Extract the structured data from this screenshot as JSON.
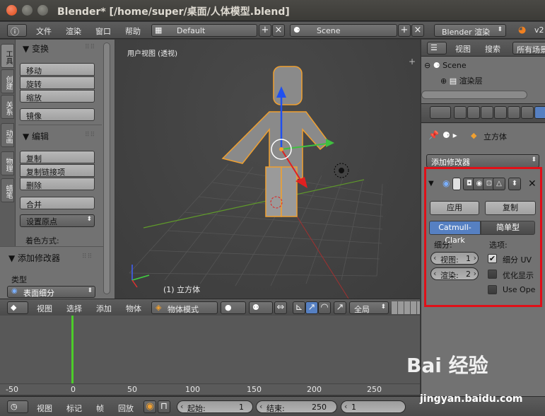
{
  "window": {
    "title": "Blender* [/home/super/桌面/人体模型.blend]"
  },
  "info_header": {
    "menus": [
      "文件",
      "渲染",
      "窗口",
      "帮助"
    ],
    "layout": "Default",
    "scene": "Scene",
    "engine": "Blender 渲染",
    "version": "v2"
  },
  "toolshelf": {
    "tabs": [
      "工具",
      "创建",
      "关系",
      "动画",
      "物理",
      "蜡笔"
    ],
    "transform_header": "▼ 变换",
    "transform_buttons": [
      "移动",
      "旋转",
      "缩放"
    ],
    "mirror": "镜像",
    "edit_header": "▼ 编辑",
    "edit_buttons": [
      "复制",
      "复制链接项",
      "删除"
    ],
    "join": "合并",
    "set_origin": "设置原点",
    "shading_label": "着色方式:",
    "operator_header": "▼ 添加修改器",
    "type_label": "类型",
    "type_value": "表面细分"
  },
  "viewport": {
    "label": "用户视图 (透视)",
    "object_label": "(1) 立方体"
  },
  "viewport_header": {
    "menus": [
      "视图",
      "选择",
      "添加",
      "物体"
    ],
    "mode": "物体模式",
    "pivot": "全局"
  },
  "timeline": {
    "ticks": [
      "-50",
      "0",
      "50",
      "100",
      "150",
      "200",
      "250"
    ],
    "menus": [
      "视图",
      "标记",
      "帧",
      "回放"
    ],
    "start_label": "起始:",
    "start_value": "1",
    "end_label": "结束:",
    "end_value": "250",
    "current": "1"
  },
  "outliner": {
    "menus": [
      "视图",
      "搜索"
    ],
    "filter": "所有场景",
    "scene": "Scene",
    "render_layers": "渲染层"
  },
  "properties": {
    "object_name": "立方体",
    "add_modifier": "添加修改器",
    "apply": "应用",
    "copy": "复制",
    "type_catmull": "Catmull-Clark",
    "type_simple": "简单型",
    "subdiv_label": "细分:",
    "view_label": "视图:",
    "view_value": "1",
    "render_label": "渲染:",
    "render_value": "2",
    "options_label": "选项:",
    "opt_uv": "细分 UV",
    "opt_optimal": "优化显示",
    "opt_opensubdiv": "Use Ope"
  },
  "watermark": {
    "text": "Bai 经验",
    "url": "jingyan.baidu.com"
  }
}
